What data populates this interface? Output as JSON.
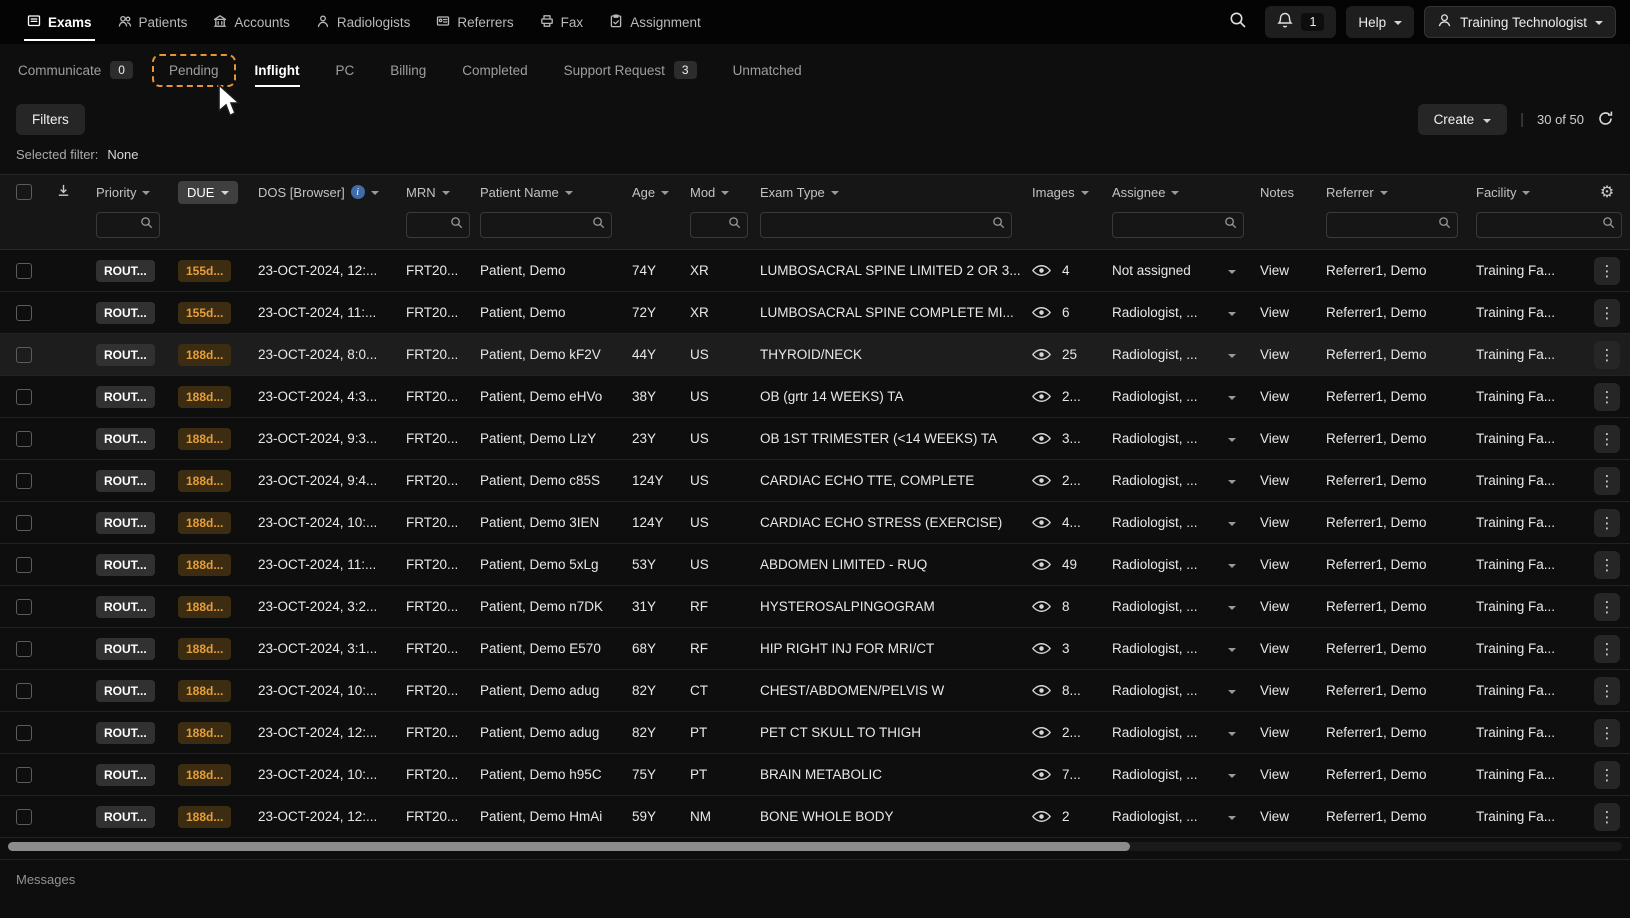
{
  "nav": {
    "items": [
      {
        "label": "Exams"
      },
      {
        "label": "Patients"
      },
      {
        "label": "Accounts"
      },
      {
        "label": "Radiologists"
      },
      {
        "label": "Referrers"
      },
      {
        "label": "Fax"
      },
      {
        "label": "Assignment"
      }
    ],
    "notification_count": "1",
    "help_label": "Help",
    "user_name": "Training Technologist"
  },
  "tabs": [
    {
      "label": "Communicate",
      "badge": "0"
    },
    {
      "label": "Pending"
    },
    {
      "label": "Inflight"
    },
    {
      "label": "PC"
    },
    {
      "label": "Billing"
    },
    {
      "label": "Completed"
    },
    {
      "label": "Support Request",
      "badge": "3"
    },
    {
      "label": "Unmatched"
    }
  ],
  "toolbar": {
    "filters_label": "Filters",
    "create_label": "Create",
    "count_label": "30 of 50"
  },
  "filter_status": {
    "label": "Selected filter:",
    "value": "None"
  },
  "table": {
    "columns": {
      "priority": "Priority",
      "due": "DUE",
      "dos": "DOS [Browser]",
      "mrn": "MRN",
      "patient": "Patient Name",
      "age": "Age",
      "mod": "Mod",
      "exam": "Exam Type",
      "images": "Images",
      "assignee": "Assignee",
      "notes": "Notes",
      "referrer": "Referrer",
      "facility": "Facility"
    },
    "rows": [
      {
        "priority": "ROUT...",
        "due": "155d...",
        "dos": "23-OCT-2024, 12:...",
        "mrn": "FRT20...",
        "patient": "Patient, Demo",
        "age": "74Y",
        "mod": "XR",
        "exam": "LUMBOSACRAL SPINE LIMITED 2 OR 3...",
        "images": "4",
        "assignee": "Not assigned",
        "notes": "View",
        "referrer": "Referrer1, Demo",
        "facility": "Training Fa..."
      },
      {
        "priority": "ROUT...",
        "due": "155d...",
        "dos": "23-OCT-2024, 11:...",
        "mrn": "FRT20...",
        "patient": "Patient, Demo",
        "age": "72Y",
        "mod": "XR",
        "exam": "LUMBOSACRAL SPINE COMPLETE MI...",
        "images": "6",
        "assignee": "Radiologist, ...",
        "notes": "View",
        "referrer": "Referrer1, Demo",
        "facility": "Training Fa..."
      },
      {
        "priority": "ROUT...",
        "due": "188d...",
        "dos": "23-OCT-2024, 8:0...",
        "mrn": "FRT20...",
        "patient": "Patient, Demo kF2V",
        "age": "44Y",
        "mod": "US",
        "exam": "THYROID/NECK",
        "images": "25",
        "assignee": "Radiologist, ...",
        "notes": "View",
        "referrer": "Referrer1, Demo",
        "facility": "Training Fa...",
        "highlighted": true
      },
      {
        "priority": "ROUT...",
        "due": "188d...",
        "dos": "23-OCT-2024, 4:3...",
        "mrn": "FRT20...",
        "patient": "Patient, Demo eHVo",
        "age": "38Y",
        "mod": "US",
        "exam": "OB (grtr 14 WEEKS) TA",
        "images": "2...",
        "assignee": "Radiologist, ...",
        "notes": "View",
        "referrer": "Referrer1, Demo",
        "facility": "Training Fa..."
      },
      {
        "priority": "ROUT...",
        "due": "188d...",
        "dos": "23-OCT-2024, 9:3...",
        "mrn": "FRT20...",
        "patient": "Patient, Demo LIzY",
        "age": "23Y",
        "mod": "US",
        "exam": "OB 1ST TRIMESTER (<14 WEEKS) TA",
        "images": "3...",
        "assignee": "Radiologist, ...",
        "notes": "View",
        "referrer": "Referrer1, Demo",
        "facility": "Training Fa..."
      },
      {
        "priority": "ROUT...",
        "due": "188d...",
        "dos": "23-OCT-2024, 9:4...",
        "mrn": "FRT20...",
        "patient": "Patient, Demo c85S",
        "age": "124Y",
        "mod": "US",
        "exam": "CARDIAC ECHO TTE, COMPLETE",
        "images": "2...",
        "assignee": "Radiologist, ...",
        "notes": "View",
        "referrer": "Referrer1, Demo",
        "facility": "Training Fa..."
      },
      {
        "priority": "ROUT...",
        "due": "188d...",
        "dos": "23-OCT-2024, 10:...",
        "mrn": "FRT20...",
        "patient": "Patient, Demo 3IEN",
        "age": "124Y",
        "mod": "US",
        "exam": "CARDIAC ECHO STRESS (EXERCISE)",
        "images": "4...",
        "assignee": "Radiologist, ...",
        "notes": "View",
        "referrer": "Referrer1, Demo",
        "facility": "Training Fa..."
      },
      {
        "priority": "ROUT...",
        "due": "188d...",
        "dos": "23-OCT-2024, 11:...",
        "mrn": "FRT20...",
        "patient": "Patient, Demo 5xLg",
        "age": "53Y",
        "mod": "US",
        "exam": "ABDOMEN LIMITED - RUQ",
        "images": "49",
        "assignee": "Radiologist, ...",
        "notes": "View",
        "referrer": "Referrer1, Demo",
        "facility": "Training Fa..."
      },
      {
        "priority": "ROUT...",
        "due": "188d...",
        "dos": "23-OCT-2024, 3:2...",
        "mrn": "FRT20...",
        "patient": "Patient, Demo n7DK",
        "age": "31Y",
        "mod": "RF",
        "exam": "HYSTEROSALPINGOGRAM",
        "images": "8",
        "assignee": "Radiologist, ...",
        "notes": "View",
        "referrer": "Referrer1, Demo",
        "facility": "Training Fa..."
      },
      {
        "priority": "ROUT...",
        "due": "188d...",
        "dos": "23-OCT-2024, 3:1...",
        "mrn": "FRT20...",
        "patient": "Patient, Demo E570",
        "age": "68Y",
        "mod": "RF",
        "exam": "HIP RIGHT INJ FOR MRI/CT",
        "images": "3",
        "assignee": "Radiologist, ...",
        "notes": "View",
        "referrer": "Referrer1, Demo",
        "facility": "Training Fa..."
      },
      {
        "priority": "ROUT...",
        "due": "188d...",
        "dos": "23-OCT-2024, 10:...",
        "mrn": "FRT20...",
        "patient": "Patient, Demo adug",
        "age": "82Y",
        "mod": "CT",
        "exam": "CHEST/ABDOMEN/PELVIS W",
        "images": "8...",
        "assignee": "Radiologist, ...",
        "notes": "View",
        "referrer": "Referrer1, Demo",
        "facility": "Training Fa..."
      },
      {
        "priority": "ROUT...",
        "due": "188d...",
        "dos": "23-OCT-2024, 12:...",
        "mrn": "FRT20...",
        "patient": "Patient, Demo adug",
        "age": "82Y",
        "mod": "PT",
        "exam": "PET CT SKULL TO THIGH",
        "images": "2...",
        "assignee": "Radiologist, ...",
        "notes": "View",
        "referrer": "Referrer1, Demo",
        "facility": "Training Fa..."
      },
      {
        "priority": "ROUT...",
        "due": "188d...",
        "dos": "23-OCT-2024, 10:...",
        "mrn": "FRT20...",
        "patient": "Patient, Demo h95C",
        "age": "75Y",
        "mod": "PT",
        "exam": "BRAIN METABOLIC",
        "images": "7...",
        "assignee": "Radiologist, ...",
        "notes": "View",
        "referrer": "Referrer1, Demo",
        "facility": "Training Fa..."
      },
      {
        "priority": "ROUT...",
        "due": "188d...",
        "dos": "23-OCT-2024, 12:...",
        "mrn": "FRT20...",
        "patient": "Patient, Demo HmAi",
        "age": "59Y",
        "mod": "NM",
        "exam": "BONE WHOLE BODY",
        "images": "2",
        "assignee": "Radiologist, ...",
        "notes": "View",
        "referrer": "Referrer1, Demo",
        "facility": "Training Fa..."
      }
    ]
  },
  "footer": {
    "messages_label": "Messages"
  },
  "icons": [
    "exams-icon",
    "patients-icon",
    "accounts-icon",
    "radiologists-icon",
    "referrers-icon",
    "fax-icon",
    "assignment-icon",
    "search-icon",
    "bell-icon",
    "person-icon",
    "chevron-down-icon",
    "download-icon",
    "info-icon",
    "gear-icon",
    "magnifier-icon",
    "eye-icon",
    "kebab-menu-icon",
    "refresh-icon",
    "mouse-cursor"
  ]
}
